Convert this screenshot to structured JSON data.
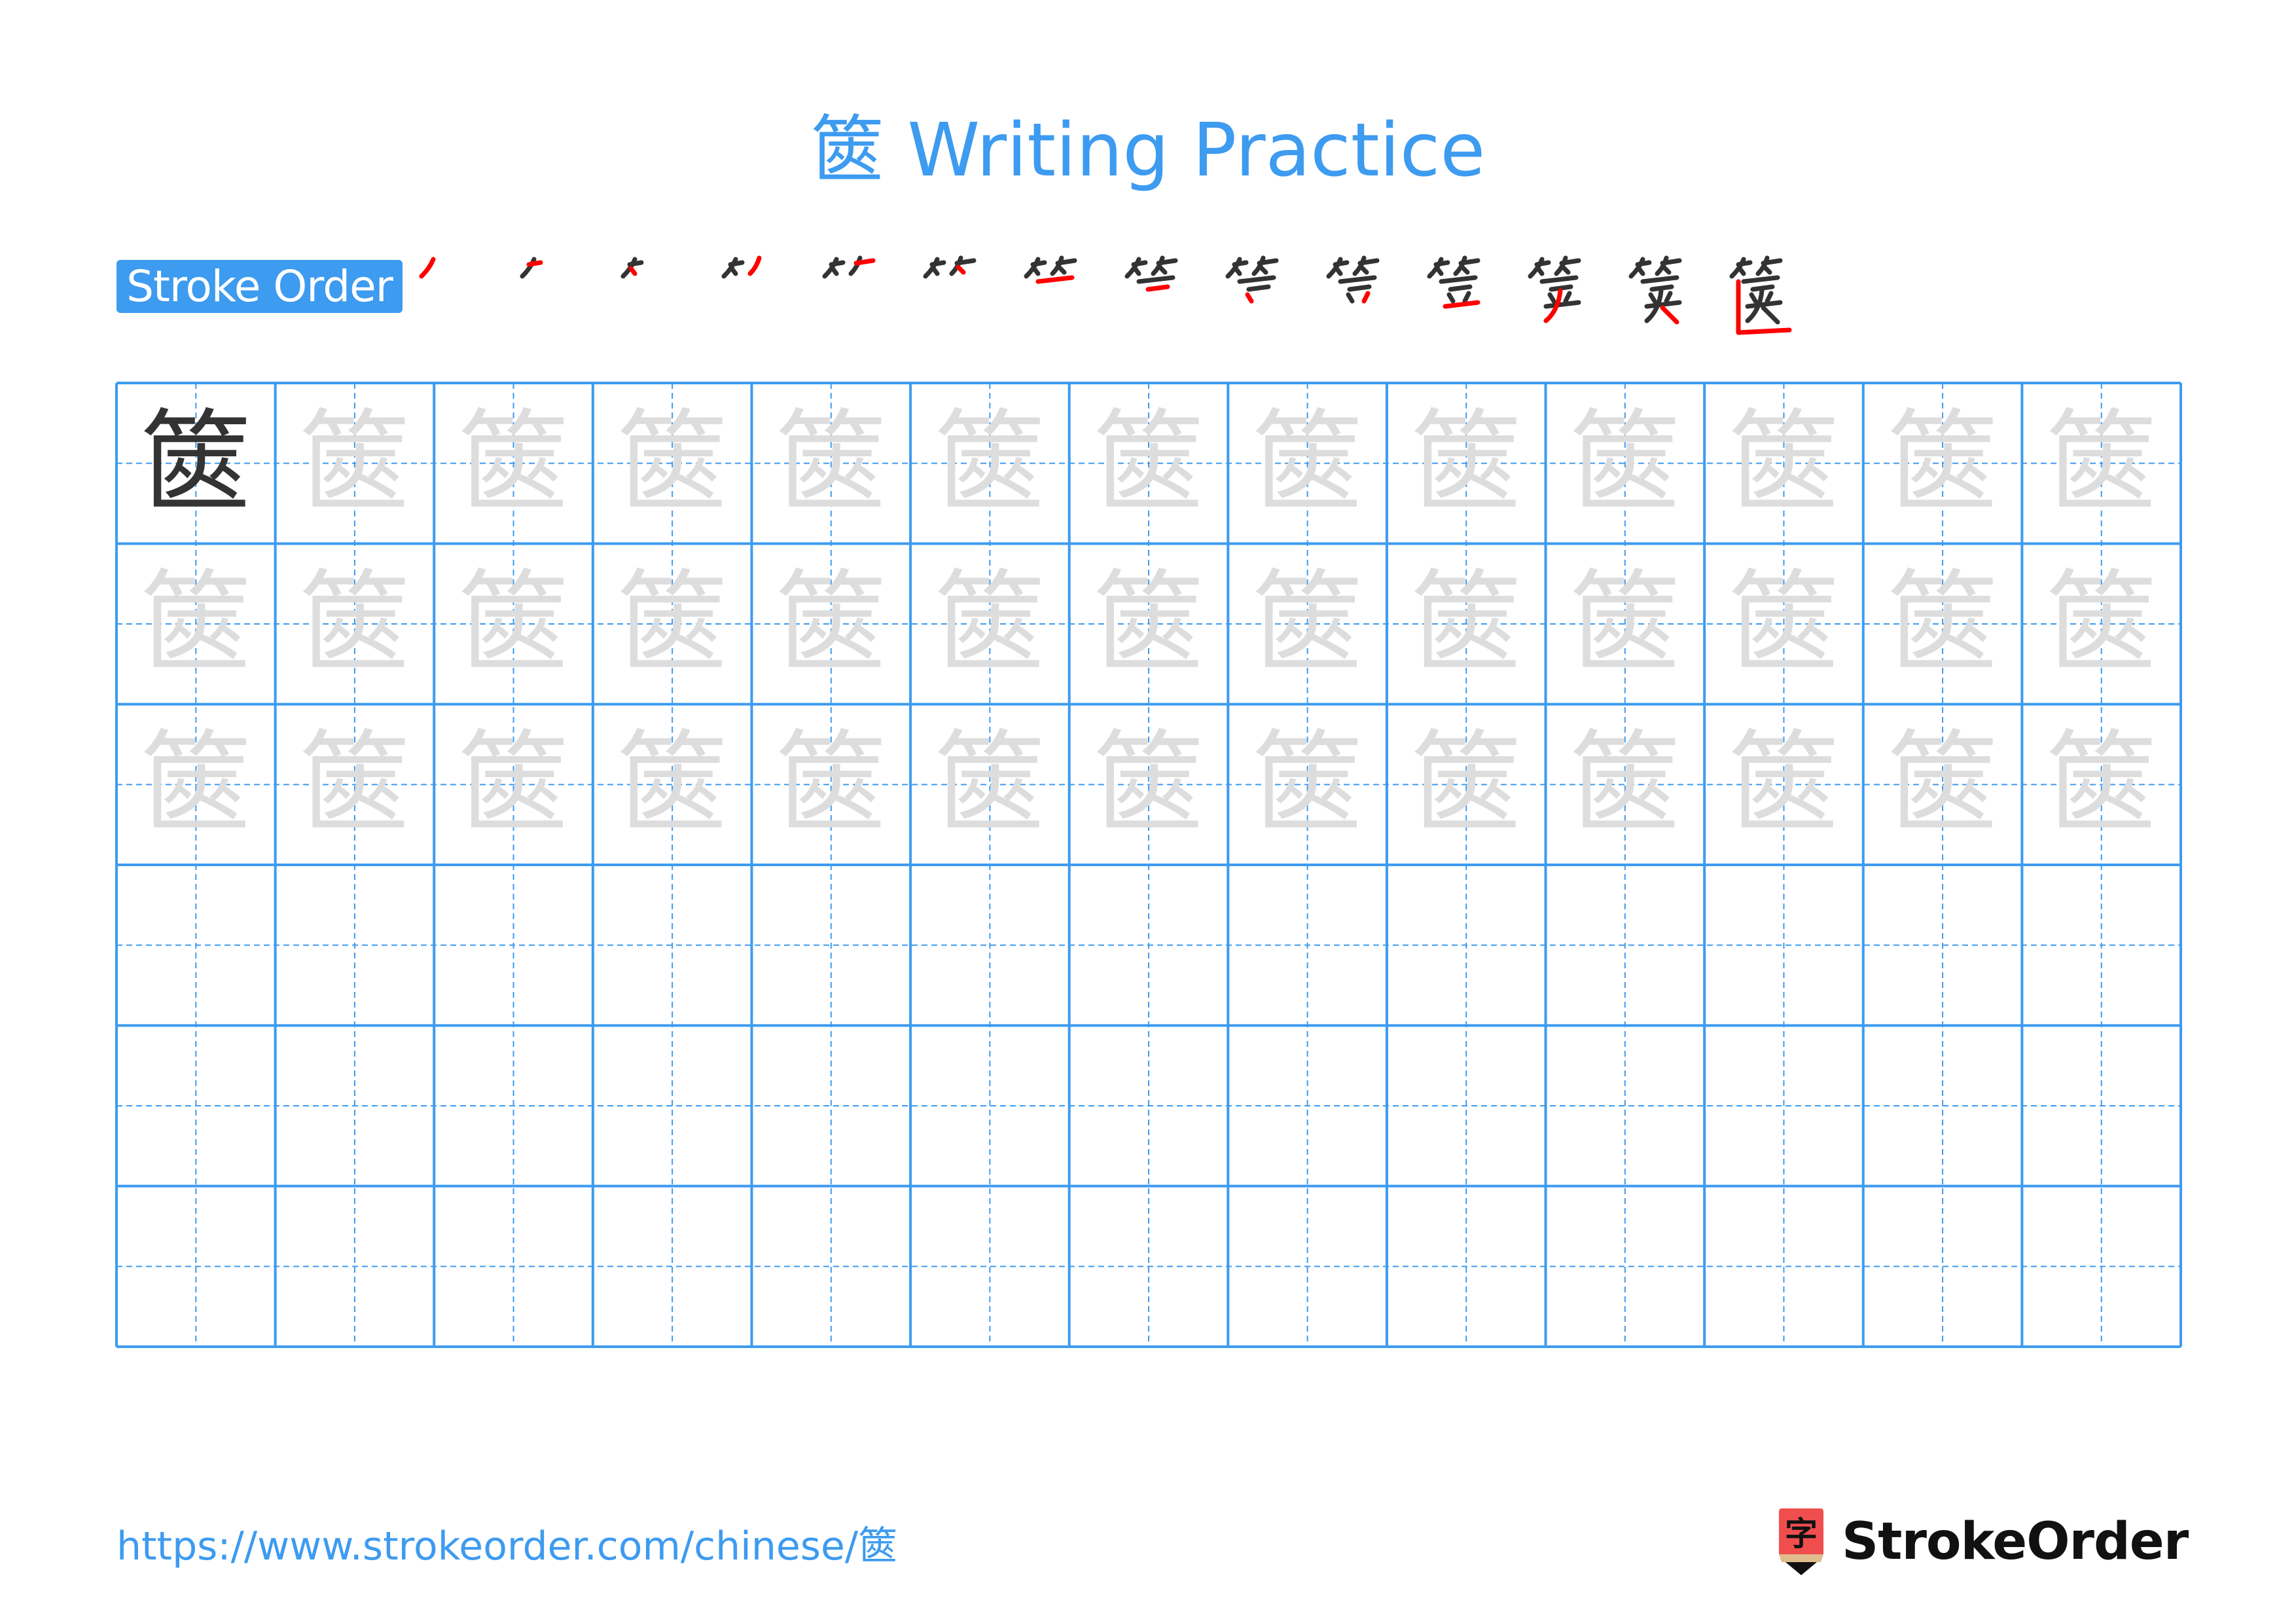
{
  "page": {
    "title_char": "篋",
    "title_suffix": " Writing Practice",
    "accent_color": "#3d9bf0",
    "stroke_color": "#333333",
    "highlight_color": "#ff0000",
    "trace_color": "#dddddd"
  },
  "stroke_order": {
    "label": "Stroke Order",
    "character": "篋",
    "total_strokes": 14,
    "steps": [
      {
        "step": 1,
        "new_stroke": "丿 left bamboo slant"
      },
      {
        "step": 2,
        "new_stroke": "一 left bamboo short horizontal"
      },
      {
        "step": 3,
        "new_stroke": "丶 left bamboo dot"
      },
      {
        "step": 4,
        "new_stroke": "丿 right bamboo slant"
      },
      {
        "step": 5,
        "new_stroke": "一 right bamboo short horizontal"
      },
      {
        "step": 6,
        "new_stroke": "丶 right bamboo dot"
      },
      {
        "step": 7,
        "new_stroke": "一 top horizontal of enclosure"
      },
      {
        "step": 8,
        "new_stroke": "一 second horizontal"
      },
      {
        "step": 9,
        "new_stroke": "丶 left dot"
      },
      {
        "step": 10,
        "new_stroke": "丿 right dot"
      },
      {
        "step": 11,
        "new_stroke": "一 long horizontal"
      },
      {
        "step": 12,
        "new_stroke": "丿 left-falling sweep"
      },
      {
        "step": 13,
        "new_stroke": "㇏ right-falling stroke"
      },
      {
        "step": 14,
        "new_stroke": "𠃊 enclosure vertical-bend"
      }
    ]
  },
  "practice_grid": {
    "columns": 13,
    "rows": 6,
    "character": "篋",
    "filled_rows": 3,
    "model_cells": 1,
    "note": "First cell shows dark model character; remaining cells of first three rows show light tracing characters; last three rows are empty."
  },
  "footer": {
    "url": "https://www.strokeorder.com/chinese/篋",
    "logo_glyph": "字",
    "logo_text": "StrokeOrder"
  }
}
